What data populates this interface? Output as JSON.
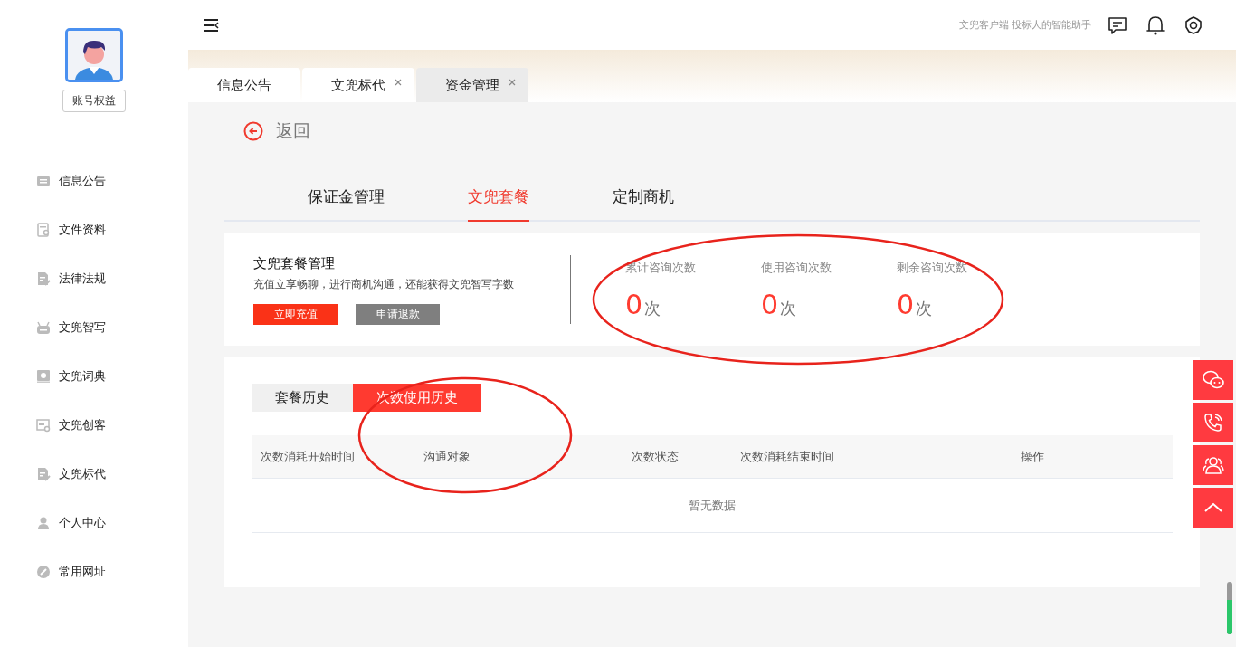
{
  "sidebar": {
    "account_button": "账号权益",
    "items": [
      {
        "label": "信息公告"
      },
      {
        "label": "文件资料"
      },
      {
        "label": "法律法规"
      },
      {
        "label": "文兜智写"
      },
      {
        "label": "文兜词典"
      },
      {
        "label": "文兜创客"
      },
      {
        "label": "文兜标代"
      },
      {
        "label": "个人中心"
      },
      {
        "label": "常用网址"
      }
    ]
  },
  "header": {
    "slogan": "文兜客户端 投标人的智能助手"
  },
  "tabs": [
    {
      "label": "信息公告",
      "closable": false,
      "selected": false
    },
    {
      "label": "文兜标代",
      "closable": true,
      "selected": false
    },
    {
      "label": "资金管理",
      "closable": true,
      "selected": true
    }
  ],
  "back_link": "返回",
  "sub_tabs": [
    {
      "label": "保证金管理",
      "selected": false
    },
    {
      "label": "文兜套餐",
      "selected": true
    },
    {
      "label": "定制商机",
      "selected": false
    }
  ],
  "package": {
    "title": "文兜套餐管理",
    "description": "充值立享畅聊，进行商机沟通，还能获得文兜智写字数",
    "buttons": [
      {
        "label": "立即充值",
        "kind": "primary"
      },
      {
        "label": "申请退款",
        "kind": "secondary"
      }
    ],
    "stats": [
      {
        "label": "累计咨询次数",
        "value": "0",
        "unit": "次"
      },
      {
        "label": "使用咨询次数",
        "value": "0",
        "unit": "次"
      },
      {
        "label": "剩余咨询次数",
        "value": "0",
        "unit": "次"
      }
    ]
  },
  "history_tabs": [
    {
      "label": "套餐历史",
      "selected": false
    },
    {
      "label": "次数使用历史",
      "selected": true
    }
  ],
  "table": {
    "columns": [
      "次数消耗开始时间",
      "沟通对象",
      "次数状态",
      "次数消耗结束时间",
      "操作"
    ],
    "empty_text": "暂无数据"
  }
}
